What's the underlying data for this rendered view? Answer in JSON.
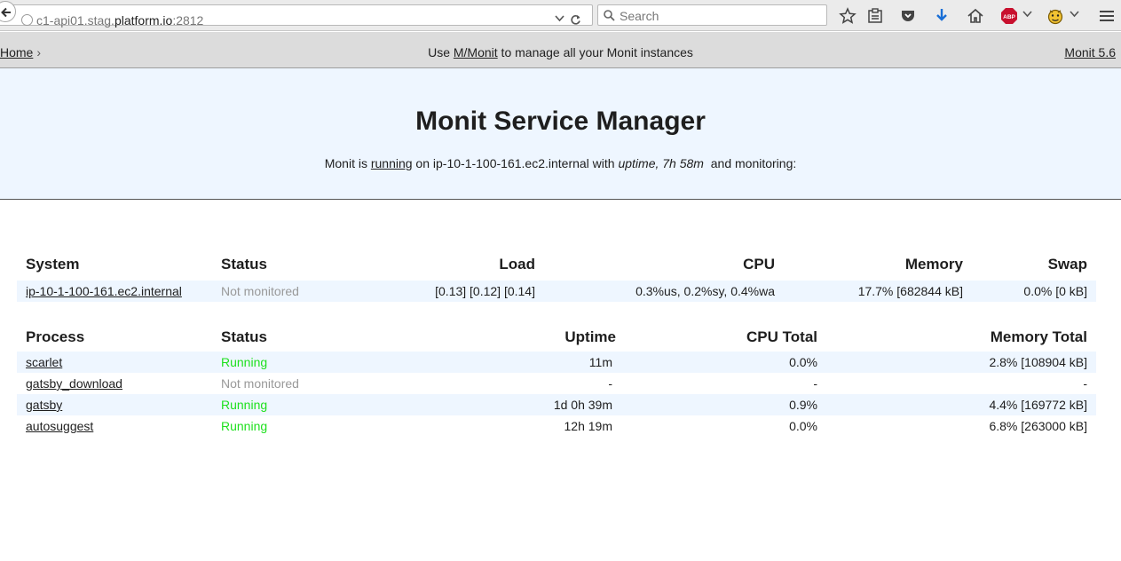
{
  "browser": {
    "url_prefix": "c1-api01.stag.",
    "url_domain": "platform.io",
    "url_suffix": ":2812",
    "search_placeholder": "Search"
  },
  "topnav": {
    "home_label": "Home",
    "crumb_sep": "›",
    "msg_pre": "Use ",
    "msg_link": "M/Monit",
    "msg_post": " to manage all your Monit instances",
    "version": "Monit 5.6"
  },
  "hero": {
    "title": "Monit Service Manager",
    "s1": "Monit is ",
    "s2": "running",
    "s3": " on ip-10-1-100-161.ec2.internal with ",
    "s4": "uptime, 7h 58m",
    "s5": "  and monitoring:"
  },
  "system_table": {
    "headers": [
      "System",
      "Status",
      "Load",
      "CPU",
      "Memory",
      "Swap"
    ],
    "rows": [
      {
        "name": "ip-10-1-100-161.ec2.internal",
        "status": "Not monitored",
        "load": "[0.13] [0.12] [0.14]",
        "cpu": "0.3%us, 0.2%sy, 0.4%wa",
        "memory": "17.7% [682844 kB]",
        "swap": "0.0% [0 kB]"
      }
    ]
  },
  "process_table": {
    "headers": [
      "Process",
      "Status",
      "Uptime",
      "CPU Total",
      "Memory Total"
    ],
    "rows": [
      {
        "name": "scarlet",
        "status": "Running",
        "uptime": "11m",
        "cpu": "0.0%",
        "memory": "2.8% [108904 kB]"
      },
      {
        "name": "gatsby_download",
        "status": "Not monitored",
        "uptime": "-",
        "cpu": "-",
        "memory": "-"
      },
      {
        "name": "gatsby",
        "status": "Running",
        "uptime": "1d 0h 39m",
        "cpu": "0.9%",
        "memory": "4.4% [169772 kB]"
      },
      {
        "name": "autosuggest",
        "status": "Running",
        "uptime": "12h 19m",
        "cpu": "0.0%",
        "memory": "6.8% [263000 kB]"
      }
    ]
  },
  "colors": {
    "running": "#1ee01e",
    "not_monitored": "#999999",
    "stripe": "#eef6ff"
  }
}
